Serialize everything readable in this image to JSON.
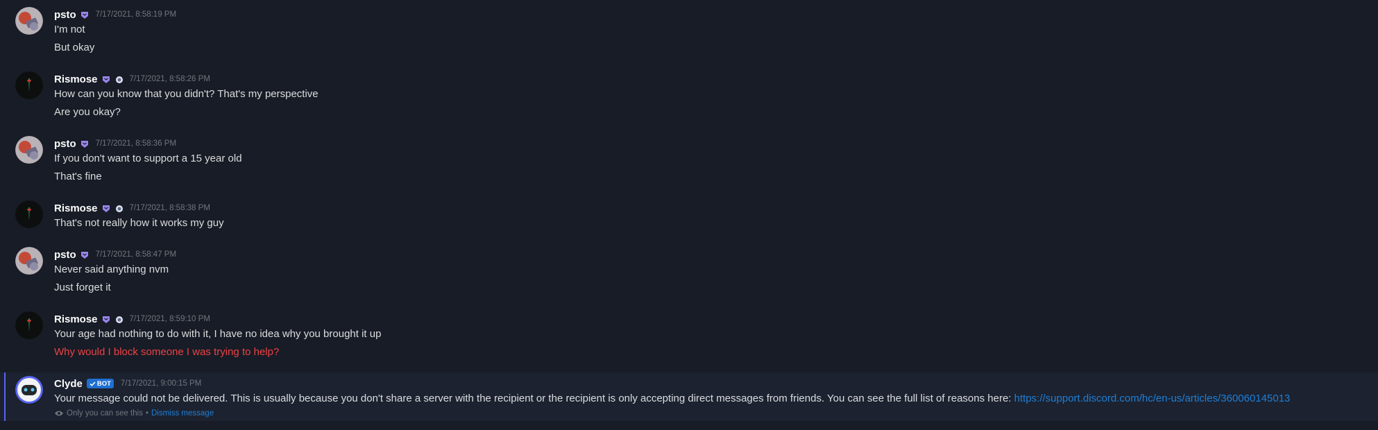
{
  "messages": [
    {
      "author": "psto",
      "timestamp": "7/17/2021, 8:58:19 PM",
      "lines": [
        "I'm not",
        "But okay"
      ]
    },
    {
      "author": "Rismose",
      "timestamp": "7/17/2021, 8:58:26 PM",
      "lines": [
        "How can you know that you didn't? That's my perspective",
        "Are you okay?"
      ]
    },
    {
      "author": "psto",
      "timestamp": "7/17/2021, 8:58:36 PM",
      "lines": [
        "If you don't want to support a 15 year old",
        "That's fine"
      ]
    },
    {
      "author": "Rismose",
      "timestamp": "7/17/2021, 8:58:38 PM",
      "lines": [
        "That's not really how it works my guy"
      ]
    },
    {
      "author": "psto",
      "timestamp": "7/17/2021, 8:58:47 PM",
      "lines": [
        "Never said anything nvm",
        "Just forget it"
      ]
    },
    {
      "author": "Rismose",
      "timestamp": "7/17/2021, 8:59:10 PM",
      "lines": [
        "Your age had nothing to do with it, I have no idea why you brought it up",
        "Why would I block someone I was trying to help?"
      ]
    }
  ],
  "clyde": {
    "author": "Clyde",
    "bot_label": "BOT",
    "timestamp": "7/17/2021, 9:00:15 PM",
    "text": "Your message could not be delivered. This is usually because you don't share a server with the recipient or the recipient is only accepting direct messages from friends. You can see the full list of reasons here: ",
    "link": "https://support.discord.com/hc/en-us/articles/360060145013",
    "only_you": "Only you can see this",
    "separator": "•",
    "dismiss": "Dismiss message"
  },
  "colors": {
    "background": "#171c26",
    "error_text": "#ed4245",
    "link": "#1e7fd6",
    "badge": "#9b84ec",
    "bot_badge": "#1f6fd1"
  },
  "icons": {
    "nitro_badge": "shield-badge-icon",
    "boost_badge": "boost-gem-icon",
    "verified_check": "check-icon",
    "eye": "eye-icon"
  }
}
